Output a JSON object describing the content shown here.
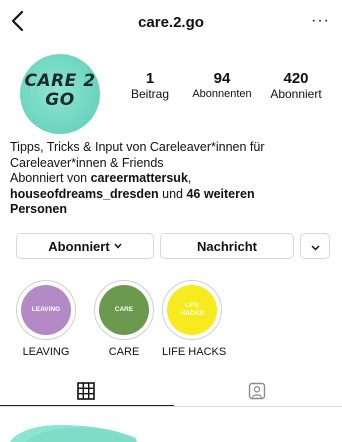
{
  "header": {
    "username": "care.2.go",
    "back_icon": "chevron-left-icon",
    "more_label": "···"
  },
  "profile": {
    "avatar_line1": "CARE 2",
    "avatar_line2": "GO",
    "avatar_color": "#6fd6c1",
    "stats": [
      {
        "value": "1",
        "label": "Beitrag"
      },
      {
        "value": "94",
        "label": "Abonnenten"
      },
      {
        "value": "420",
        "label": "Abonniert"
      }
    ],
    "bio_line1": "Tipps, Tricks & Input von Careleaver*innen für",
    "bio_line2": "Careleaver*innen & Friends",
    "followed_prefix": "Abonniert von ",
    "followed_user1": "careermattersuk",
    "followed_sep": ",",
    "followed_user2": "houseofdreams_dresden",
    "followed_and": " und ",
    "followed_more": "46 weiteren",
    "followed_more2": "Personen"
  },
  "buttons": {
    "follow_label": "Abonniert",
    "message_label": "Nachricht"
  },
  "highlights": [
    {
      "circle_text": "LEAVING",
      "caption": "LEAVING",
      "color": "#b48ac6"
    },
    {
      "circle_text": "CARE",
      "caption": "CARE",
      "color": "#6b9a4e"
    },
    {
      "circle_text": "LIFE\nHACKS",
      "caption": "LIFE HACKS",
      "color": "#f7ea1f"
    }
  ],
  "tabs": {
    "grid_icon": "grid-icon",
    "tagged_icon": "tagged-person-icon"
  }
}
